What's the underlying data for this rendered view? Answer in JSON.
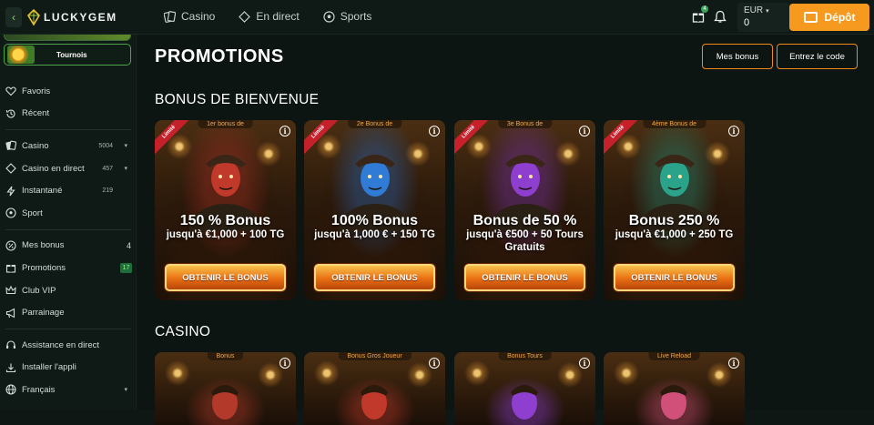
{
  "header": {
    "logo_text": "LUCKYGEM",
    "nav": [
      {
        "label": "Casino",
        "icon": "cards-icon"
      },
      {
        "label": "En direct",
        "icon": "live-icon"
      },
      {
        "label": "Sports",
        "icon": "football-icon"
      }
    ],
    "gift_badge": "4",
    "currency": "EUR",
    "balance": "0",
    "deposit_label": "Dépôt"
  },
  "sidebar": {
    "tournois_label": "Tournois",
    "group1": [
      {
        "label": "Favoris",
        "icon": "heart-icon"
      },
      {
        "label": "Récent",
        "icon": "history-icon"
      }
    ],
    "group2": [
      {
        "label": "Casino",
        "icon": "cards-icon",
        "count": "5004"
      },
      {
        "label": "Casino en direct",
        "icon": "live-icon",
        "count": "457"
      },
      {
        "label": "Instantané",
        "icon": "lightning-icon",
        "count": "219"
      },
      {
        "label": "Sport",
        "icon": "football-icon"
      }
    ],
    "group3": [
      {
        "label": "Mes bonus",
        "icon": "percent-icon",
        "num": "4"
      },
      {
        "label": "Promotions",
        "icon": "gift-icon",
        "badge": "17"
      },
      {
        "label": "Club VIP",
        "icon": "crown-icon"
      },
      {
        "label": "Parrainage",
        "icon": "megaphone-icon"
      }
    ],
    "group4": [
      {
        "label": "Assistance en direct",
        "icon": "support-icon"
      },
      {
        "label": "Installer l'appli",
        "icon": "download-icon"
      },
      {
        "label": "Français",
        "icon": "globe-icon"
      }
    ]
  },
  "main": {
    "title": "PROMOTIONS",
    "my_bonus_label": "Mes bonus",
    "enter_code_label": "Entrez le code",
    "welcome_title": "BONUS DE BIENVENUE",
    "casino_title": "CASINO",
    "welcome_cards": [
      {
        "tag": "1er bonus de",
        "ribbon": "Limité",
        "big": "150 % Bonus",
        "sub": "jusqu'à €1,000 + 100 TG",
        "cta": "OBTENIR LE BONUS",
        "accent": "#c0392b"
      },
      {
        "tag": "2e Bonus de",
        "ribbon": "Limité",
        "big": "100% Bonus",
        "sub": "jusqu'à 1,000 € + 150 TG",
        "cta": "OBTENIR LE BONUS",
        "accent": "#2f7bd6"
      },
      {
        "tag": "3e Bonus de",
        "ribbon": "Limité",
        "big": "Bonus de 50 %",
        "sub": "jusqu'à €500 + 50 Tours Gratuits",
        "cta": "OBTENIR LE BONUS",
        "accent": "#8e3fd0"
      },
      {
        "tag": "4ème Bonus de",
        "ribbon": "Limité",
        "big": "Bonus 250 %",
        "sub": "jusqu'à €1,000 + 250 TG",
        "cta": "OBTENIR LE BONUS",
        "accent": "#2aa38a"
      }
    ],
    "casino_cards": [
      {
        "tag": "Bonus",
        "accent": "#b33a2a"
      },
      {
        "tag": "Bonus Gros Joueur",
        "accent": "#c0392b"
      },
      {
        "tag": "Bonus Tours",
        "accent": "#8e3fd0"
      },
      {
        "tag": "Live Reload",
        "accent": "#d0507a"
      }
    ]
  }
}
